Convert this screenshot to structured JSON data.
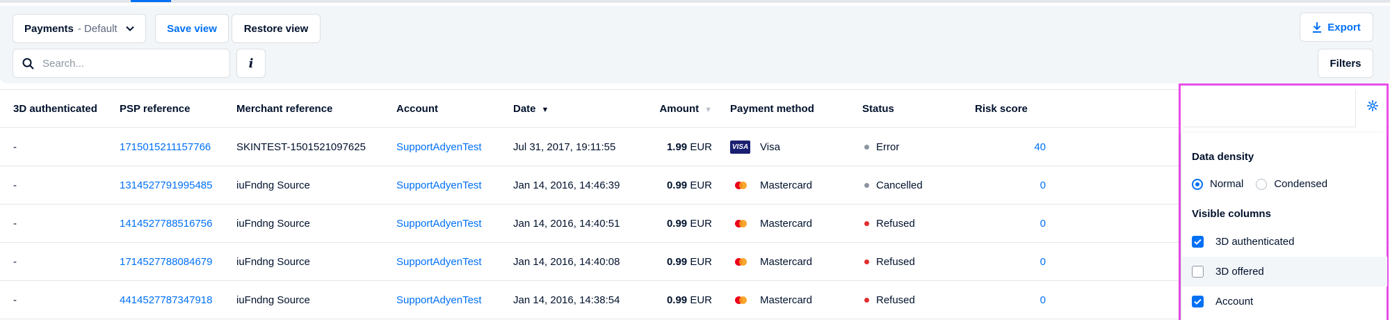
{
  "toolbar": {
    "view_name": "Payments",
    "view_suffix": "- Default",
    "save_view": "Save view",
    "restore_view": "Restore view",
    "export": "Export",
    "filters": "Filters",
    "info": "i"
  },
  "search": {
    "placeholder": "Search..."
  },
  "table": {
    "headers": [
      "3D authenticated",
      "PSP reference",
      "Merchant reference",
      "Account",
      "Date",
      "Amount",
      "Payment method",
      "Status",
      "Risk score"
    ],
    "rows": [
      {
        "auth": "-",
        "psp": "1715015211157766",
        "merchant": "SKINTEST-1501521097625",
        "account": "SupportAdyenTest",
        "date": "Jul 31, 2017, 19:11:55",
        "amount": "1.99",
        "currency": "EUR",
        "method": "Visa",
        "method_icon": "visa-card-icon",
        "status": "Error",
        "status_color": "#8d95a3",
        "risk": "40"
      },
      {
        "auth": "-",
        "psp": "1314527791995485",
        "merchant": "iuFndng Source",
        "account": "SupportAdyenTest",
        "date": "Jan 14, 2016, 14:46:39",
        "amount": "0.99",
        "currency": "EUR",
        "method": "Mastercard",
        "method_icon": "mastercard-icon",
        "status": "Cancelled",
        "status_color": "#8d95a3",
        "risk": "0"
      },
      {
        "auth": "-",
        "psp": "1414527788516756",
        "merchant": "iuFndng Source",
        "account": "SupportAdyenTest",
        "date": "Jan 14, 2016, 14:40:51",
        "amount": "0.99",
        "currency": "EUR",
        "method": "Mastercard",
        "method_icon": "mastercard-icon",
        "status": "Refused",
        "status_color": "#e22d2d",
        "risk": "0"
      },
      {
        "auth": "-",
        "psp": "1714527788084679",
        "merchant": "iuFndng Source",
        "account": "SupportAdyenTest",
        "date": "Jan 14, 2016, 14:40:08",
        "amount": "0.99",
        "currency": "EUR",
        "method": "Mastercard",
        "method_icon": "mastercard-icon",
        "status": "Refused",
        "status_color": "#e22d2d",
        "risk": "0"
      },
      {
        "auth": "-",
        "psp": "4414527787347918",
        "merchant": "iuFndng Source",
        "account": "SupportAdyenTest",
        "date": "Jan 14, 2016, 14:38:54",
        "amount": "0.99",
        "currency": "EUR",
        "method": "Mastercard",
        "method_icon": "mastercard-icon",
        "status": "Refused",
        "status_color": "#e22d2d",
        "risk": "0"
      }
    ]
  },
  "column_settings": {
    "data_density_title": "Data density",
    "density_options": [
      {
        "label": "Normal",
        "selected": true
      },
      {
        "label": "Condensed",
        "selected": false
      }
    ],
    "visible_columns_title": "Visible columns",
    "columns": [
      {
        "label": "3D authenticated",
        "checked": true
      },
      {
        "label": "3D offered",
        "checked": false
      },
      {
        "label": "Account",
        "checked": true
      }
    ]
  },
  "icons": {
    "chevron": "chevron-down-icon",
    "download": "download-icon",
    "search": "search-icon",
    "settings": "gear-icon"
  },
  "colors": {
    "accent": "#0070f5",
    "highlight_border": "#e84ee8",
    "error_red": "#e22d2d",
    "neutral_grey": "#8d95a3"
  }
}
